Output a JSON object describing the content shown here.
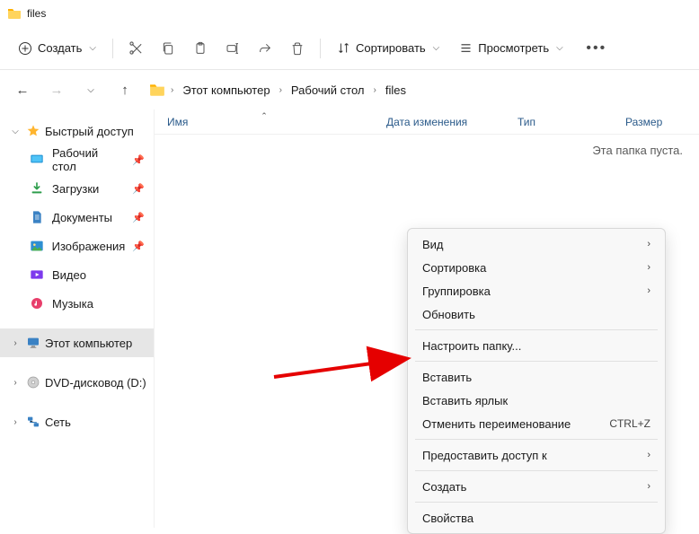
{
  "window": {
    "title": "files"
  },
  "toolbar": {
    "new_label": "Создать",
    "sort_label": "Сортировать",
    "view_label": "Просмотреть"
  },
  "breadcrumb": {
    "items": [
      "Этот компьютер",
      "Рабочий стол",
      "files"
    ]
  },
  "sidebar": {
    "quick_access": "Быстрый доступ",
    "desktop": "Рабочий стол",
    "downloads": "Загрузки",
    "documents": "Документы",
    "pictures": "Изображения",
    "videos": "Видео",
    "music": "Музыка",
    "this_pc": "Этот компьютер",
    "dvd": "DVD-дисковод (D:)",
    "network": "Сеть"
  },
  "columns": {
    "name": "Имя",
    "date": "Дата изменения",
    "type": "Тип",
    "size": "Размер"
  },
  "content": {
    "empty": "Эта папка пуста."
  },
  "context_menu": {
    "view": "Вид",
    "sort": "Сортировка",
    "group": "Группировка",
    "refresh": "Обновить",
    "customize": "Настроить папку...",
    "paste": "Вставить",
    "paste_shortcut": "Вставить ярлык",
    "undo_rename": "Отменить переименование",
    "undo_shortcut": "CTRL+Z",
    "give_access": "Предоставить доступ к",
    "new": "Создать",
    "properties": "Свойства"
  }
}
